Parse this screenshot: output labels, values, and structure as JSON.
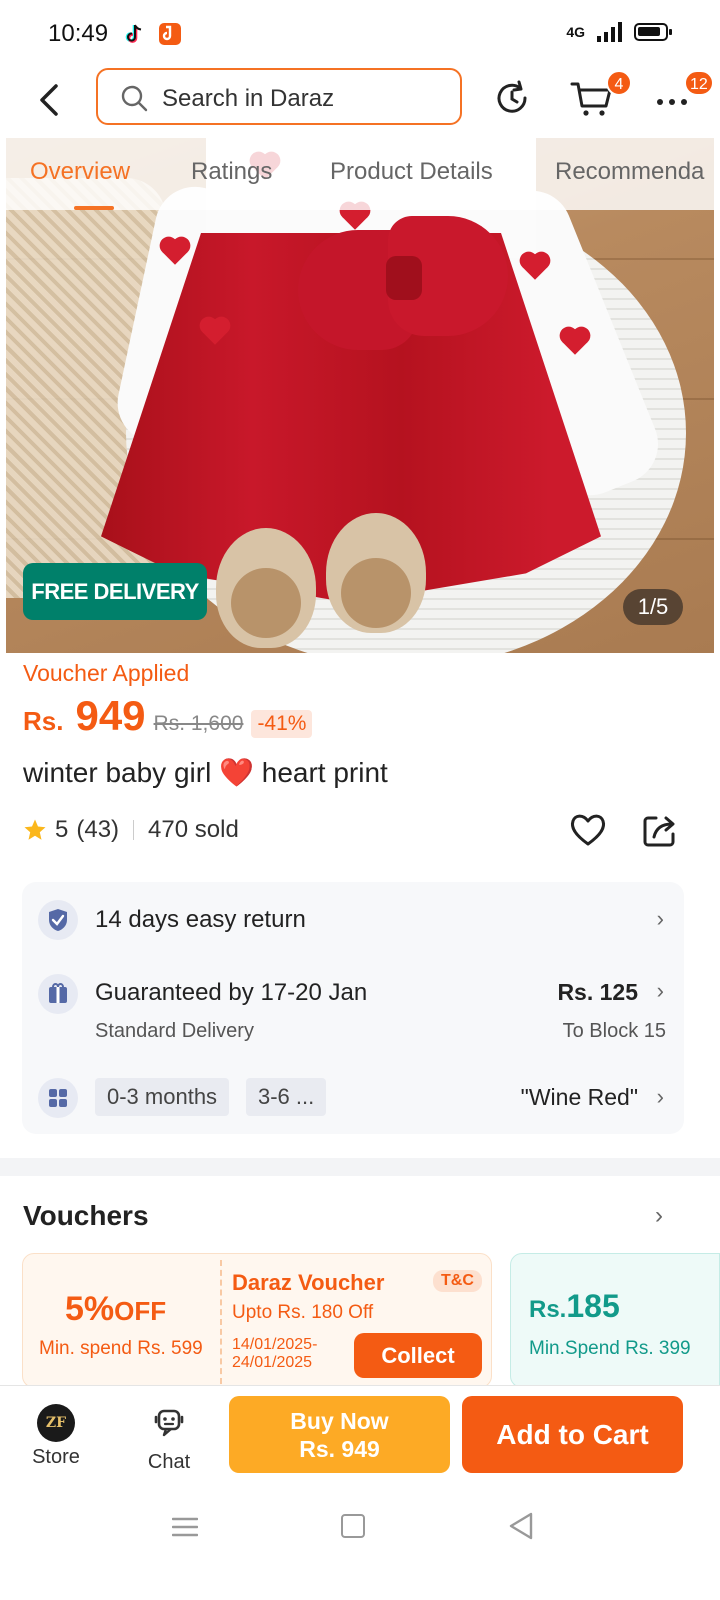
{
  "status_bar": {
    "time": "10:49",
    "network": "4G",
    "apps": [
      "tiktok-icon",
      "app-icon"
    ]
  },
  "header": {
    "search_placeholder": "Search in Daraz",
    "cart_count": "4",
    "more_count": "12"
  },
  "tabs": [
    {
      "label": "Overview",
      "active": true
    },
    {
      "label": "Ratings",
      "active": false
    },
    {
      "label": "Product Details",
      "active": false
    },
    {
      "label": "Recommenda",
      "active": false
    }
  ],
  "gallery": {
    "free_delivery": "FREE DELIVERY",
    "counter": "1/5"
  },
  "price": {
    "voucher_label": "Voucher Applied",
    "currency": "Rs.",
    "value": "949",
    "original": "Rs. 1,600",
    "discount": "-41%"
  },
  "product": {
    "title_pre": "winter baby girl",
    "title_emoji": "❤️",
    "title_post": "heart print",
    "rating": "5",
    "rating_count": "(43)",
    "sold": "470 sold"
  },
  "services": {
    "return_text": "14 days easy return",
    "delivery_text": "Guaranteed by 17-20 Jan",
    "delivery_sub": "Standard Delivery",
    "delivery_price": "Rs. 125",
    "delivery_location": "To Block 15",
    "variants": [
      "0-3 months",
      "3-6 ..."
    ],
    "color": "\"Wine Red\""
  },
  "vouchers": {
    "title": "Vouchers",
    "card1": {
      "percent": "5%",
      "off": "OFF",
      "min_spend": "Min. spend Rs. 599",
      "name": "Daraz Voucher",
      "upto": "Upto Rs. 180 Off",
      "dates": "14/01/2025-24/01/2025",
      "tc": "T&C",
      "collect": "Collect"
    },
    "card2": {
      "currency": "Rs.",
      "amount": "185",
      "min_spend": "Min.Spend Rs. 399"
    }
  },
  "bottom_bar": {
    "store_label": "Store",
    "store_logo": "ZF",
    "chat_label": "Chat",
    "buy_now_label": "Buy Now",
    "buy_now_price": "Rs. 949",
    "add_to_cart_label": "Add to Cart"
  },
  "colors": {
    "accent": "#f57224",
    "price": "#f45b13",
    "free_delivery": "#00806a",
    "buy_now": "#fdaa25"
  }
}
